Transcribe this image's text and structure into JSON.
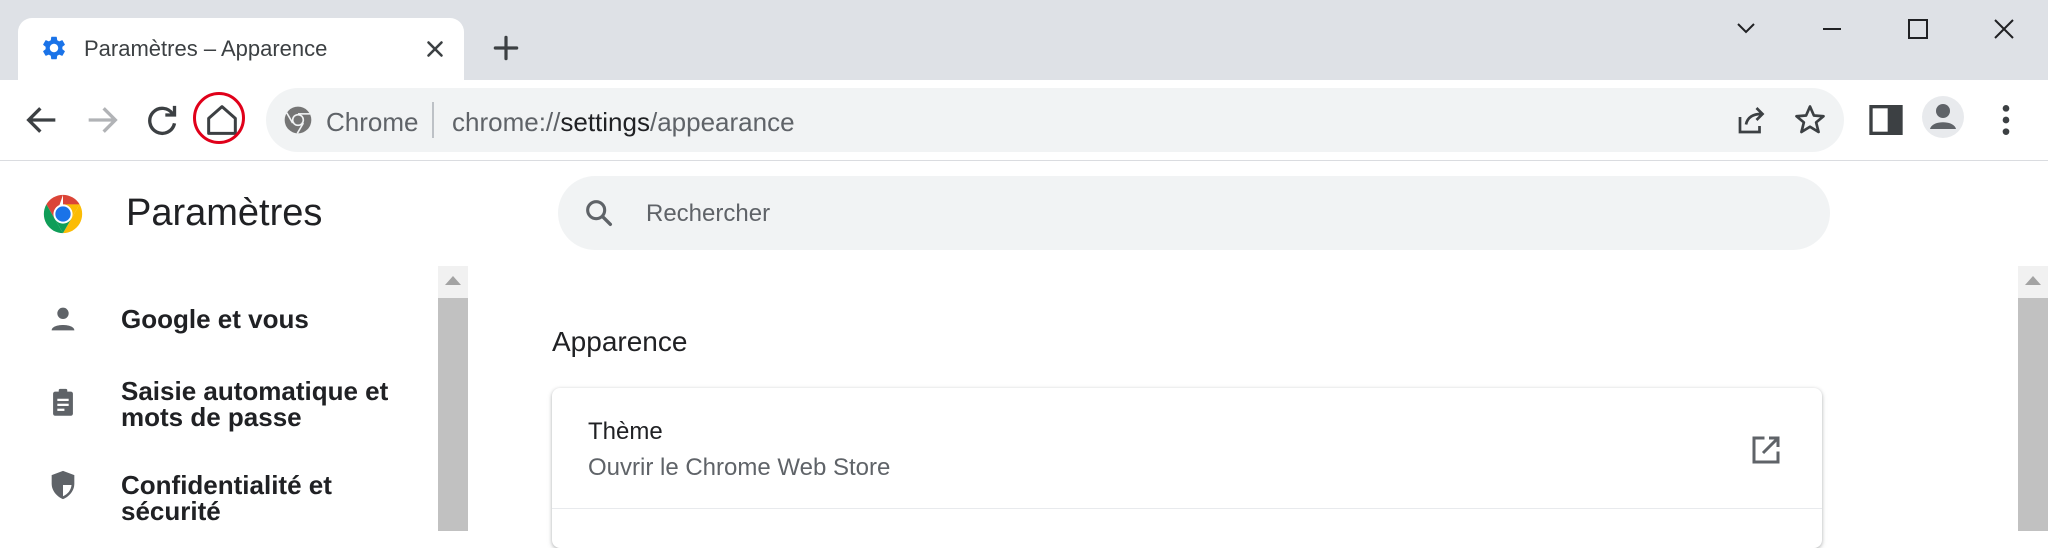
{
  "browser": {
    "tab": {
      "title": "Paramètres – Apparence",
      "favicon": "gear-icon"
    },
    "new_tab_icon": "plus-icon",
    "window_controls": [
      "chevron-down-icon",
      "minimize-icon",
      "maximize-icon",
      "close-icon"
    ],
    "toolbar": {
      "back_icon": "back-arrow-icon",
      "forward_icon": "forward-arrow-icon",
      "reload_icon": "reload-icon",
      "home_icon": "home-icon",
      "highlight_color": "#e0001a"
    },
    "omnibox": {
      "chip_label": "Chrome",
      "url_scheme": "chrome://",
      "url_host": "settings",
      "url_path": "/appearance"
    }
  },
  "settings": {
    "title": "Paramètres",
    "search_placeholder": "Rechercher",
    "nav": [
      {
        "label": "Google et vous",
        "icon": "person-icon"
      },
      {
        "label_line1": "Saisie automatique et",
        "label_line2": "mots de passe",
        "icon": "clipboard-icon"
      },
      {
        "label": "Confidentialité et sécurité",
        "icon": "shield-icon"
      }
    ],
    "section_title": "Apparence",
    "card": {
      "row_title": "Thème",
      "row_subtitle": "Ouvrir le Chrome Web Store",
      "row_icon": "open-in-new-icon"
    }
  },
  "colors": {
    "tab_strip": "#dee1e6",
    "omnibox_bg": "#f1f3f4",
    "accent_blue": "#1a73e8"
  }
}
